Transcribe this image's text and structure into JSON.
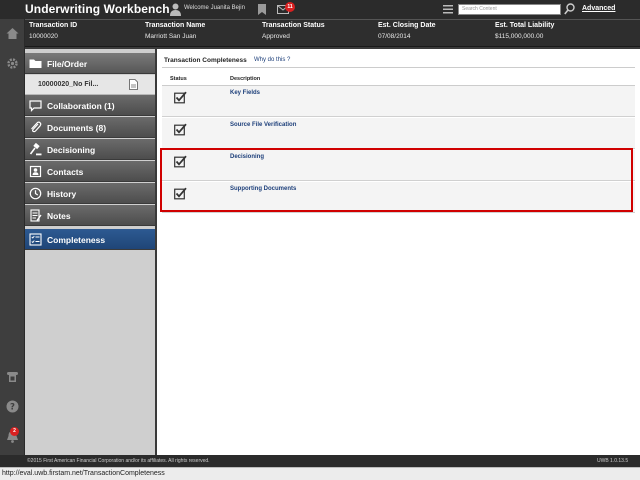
{
  "header": {
    "app_title": "Underwriting Workbench",
    "welcome": "Welcome Juanita Bejin",
    "mail_count": "11",
    "search_placeholder": "Search Content",
    "advanced_label": "Advanced"
  },
  "transaction": {
    "columns": [
      {
        "label": "Transaction ID",
        "value": "10000020"
      },
      {
        "label": "Transaction Name",
        "value": "Marriott San Juan"
      },
      {
        "label": "Transaction Status",
        "value": "Approved"
      },
      {
        "label": "Est. Closing Date",
        "value": "07/08/2014"
      },
      {
        "label": "Est. Total Liability",
        "value": "$115,000,000.00"
      }
    ]
  },
  "rail": {
    "icons": [
      "home-icon",
      "gear-icon",
      "phone-icon",
      "help-icon",
      "bell-icon"
    ],
    "notification_count": "2"
  },
  "sidebar": {
    "header_label": "File/Order",
    "sub_item_label": "10000020_No Fil...",
    "items": [
      {
        "label": "Collaboration (1)",
        "icon": "chat-icon"
      },
      {
        "label": "Documents (8)",
        "icon": "paperclip-icon"
      },
      {
        "label": "Decisioning",
        "icon": "gavel-icon"
      },
      {
        "label": "Contacts",
        "icon": "contacts-icon"
      },
      {
        "label": "History",
        "icon": "clock-icon"
      },
      {
        "label": "Notes",
        "icon": "notes-icon"
      },
      {
        "label": "Completeness",
        "icon": "checklist-icon"
      }
    ],
    "active_index": 6
  },
  "main": {
    "title": "Transaction Completeness",
    "why_link": "Why do this ?",
    "col_status": "Status",
    "col_description": "Description",
    "rows": [
      {
        "description": "Key Fields",
        "status": "checked"
      },
      {
        "description": "Source File Verification",
        "status": "checked"
      },
      {
        "description": "Decisioning",
        "status": "checked"
      },
      {
        "description": "Supporting Documents",
        "status": "checked"
      }
    ]
  },
  "footer": {
    "copyright": "©2015 First American Financial Corporation and/or its affiliates. All rights reserved.",
    "version": "UWB 1.0.13.5"
  },
  "statusbar": {
    "url": "http://eval.uwb.firstam.net/TransactionCompleteness"
  },
  "colors": {
    "active_nav": "#2d5a92",
    "link": "#1d3f7a",
    "highlight": "#d00000",
    "badge": "#d92020"
  }
}
